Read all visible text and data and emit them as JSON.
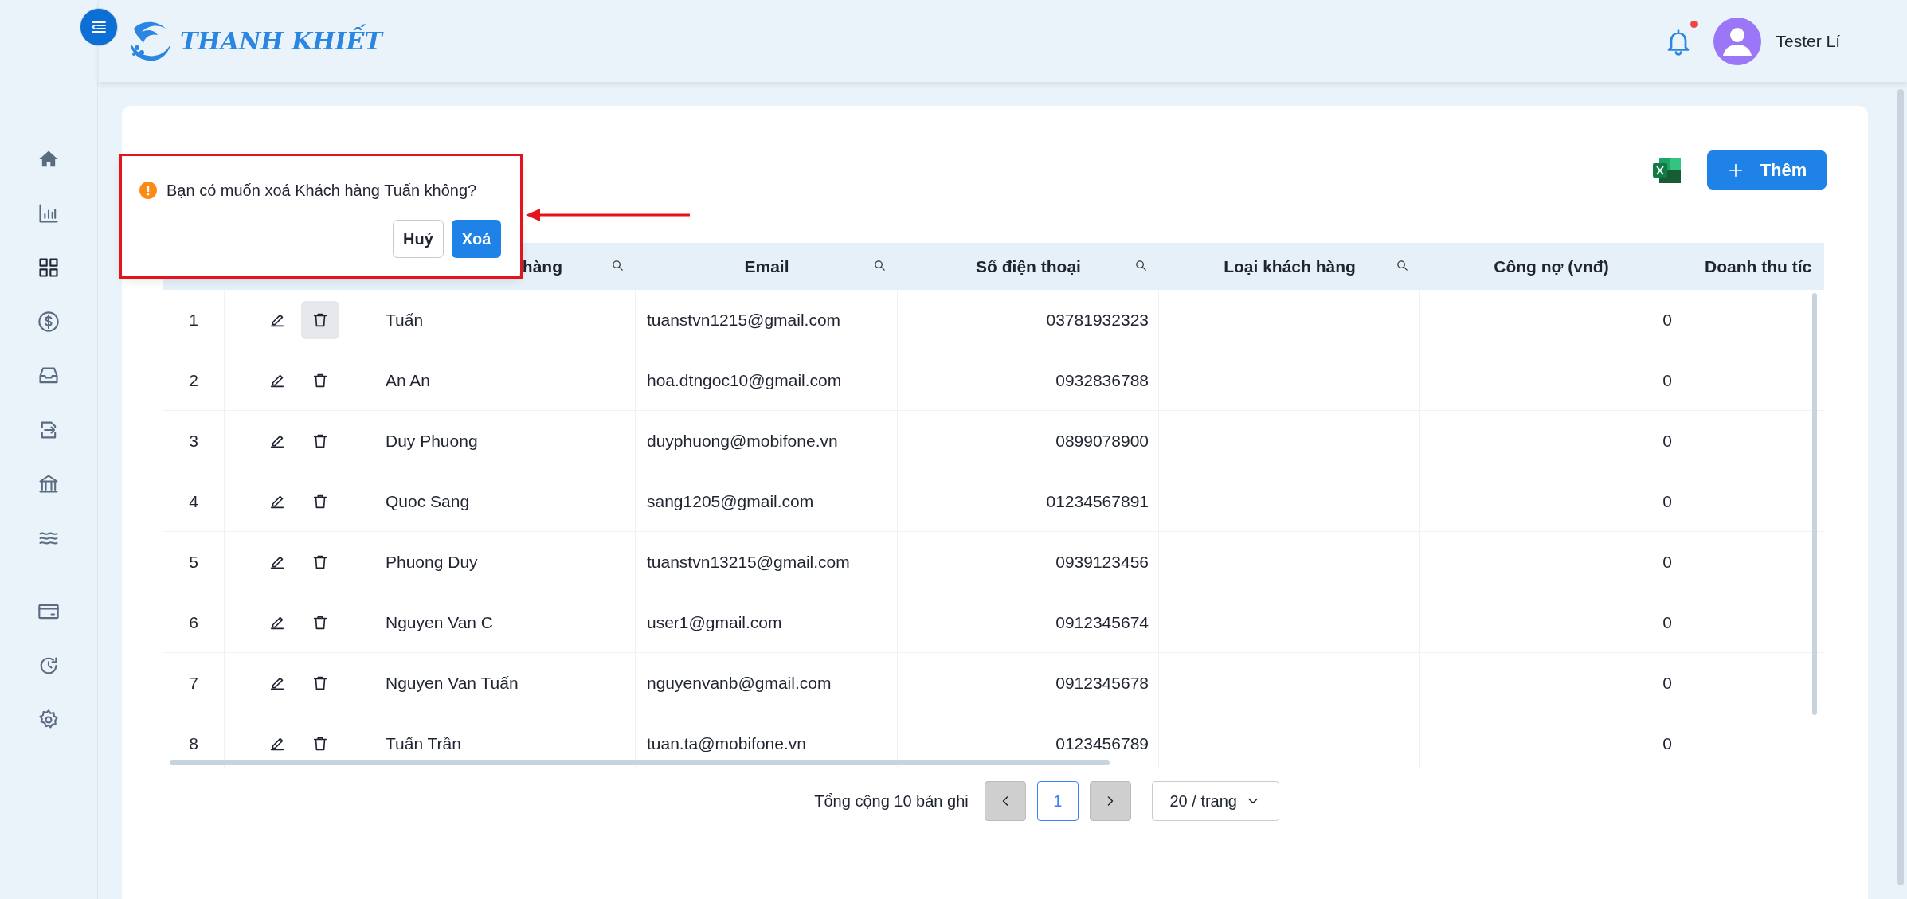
{
  "header": {
    "brand": "THANH KHIẾT",
    "user_name": "Tester Lí",
    "has_notification": true
  },
  "sidebar": {
    "items": [
      {
        "kind": "home",
        "selected": false
      },
      {
        "kind": "chart",
        "selected": false
      },
      {
        "kind": "grid",
        "selected": true
      },
      {
        "kind": "dollar",
        "selected": false
      },
      {
        "kind": "inbox",
        "selected": false
      },
      {
        "kind": "transfer",
        "selected": false
      },
      {
        "kind": "bank",
        "selected": false
      },
      {
        "kind": "waves",
        "selected": false
      },
      {
        "kind": "card",
        "selected": false
      },
      {
        "kind": "history",
        "selected": false
      },
      {
        "kind": "settings",
        "selected": false
      }
    ]
  },
  "toolbar": {
    "add_button": "Thêm"
  },
  "table": {
    "columns": [
      {},
      {},
      {
        "label": "hàng",
        "searchable": true
      },
      {
        "label": "Email",
        "searchable": true
      },
      {
        "label": "Số điện thoại",
        "searchable": true
      },
      {
        "label": "Loại khách hàng",
        "searchable": true
      },
      {
        "label": "Công nợ (vnđ)"
      },
      {
        "label": "Doanh thu tíc"
      }
    ],
    "rows": [
      {
        "index": "1",
        "name": "Tuấn",
        "email": "tuanstvn1215@gmail.com",
        "phone": "03781932323",
        "debt": "0",
        "delete_highlighted": true
      },
      {
        "index": "2",
        "name": "An An",
        "email": "hoa.dtngoc10@gmail.com",
        "phone": "0932836788",
        "debt": "0",
        "delete_highlighted": false
      },
      {
        "index": "3",
        "name": "Duy Phuong",
        "email": "duyphuong@mobifone.vn",
        "phone": "0899078900",
        "debt": "0",
        "delete_highlighted": false
      },
      {
        "index": "4",
        "name": "Quoc Sang",
        "email": "sang1205@gmail.com",
        "phone": "01234567891",
        "debt": "0",
        "delete_highlighted": false
      },
      {
        "index": "5",
        "name": "Phuong Duy",
        "email": "tuanstvn13215@gmail.com",
        "phone": "0939123456",
        "debt": "0",
        "delete_highlighted": false
      },
      {
        "index": "6",
        "name": "Nguyen Van C",
        "email": "user1@gmail.com",
        "phone": "0912345674",
        "debt": "0",
        "delete_highlighted": false
      },
      {
        "index": "7",
        "name": "Nguyen Van Tuấn",
        "email": "nguyenvanb@gmail.com",
        "phone": "0912345678",
        "debt": "0",
        "delete_highlighted": false
      },
      {
        "index": "8",
        "name": "Tuấn Trần",
        "email": "tuan.ta@mobifone.vn",
        "phone": "0123456789",
        "debt": "0",
        "delete_highlighted": false
      }
    ]
  },
  "pagination": {
    "total": "Tổng cộng 10 bản ghi",
    "pages": [
      {
        "label": "1",
        "selected": true
      }
    ],
    "page_size": "20 / trang"
  },
  "confirm_popover": {
    "message": "Bạn có muốn xoá Khách hàng Tuấn không?",
    "cancel": "Huỷ",
    "confirm": "Xoá"
  }
}
